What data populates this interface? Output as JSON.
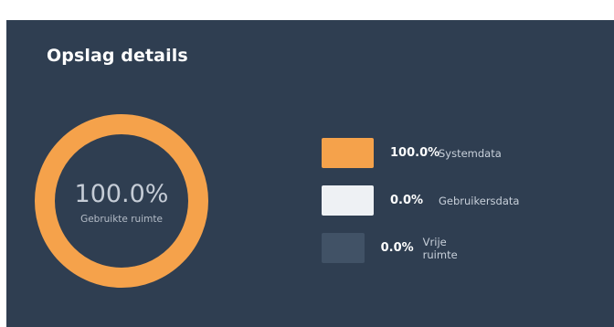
{
  "panel": {
    "title": "Opslag details"
  },
  "usage": {
    "value": "100.0%",
    "label": "Gebruikte ruimte",
    "used_fraction": 1.0
  },
  "legend": [
    {
      "percent": "100.0%",
      "label": "Systemdata",
      "color": "#f5a24b"
    },
    {
      "percent": "0.0%",
      "label": "Gebruikersdata",
      "color": "#eef1f4"
    },
    {
      "percent": "0.0%",
      "label": "Vrije ruimte",
      "color": "#415266"
    }
  ],
  "colors": {
    "panel_background": "#2f3e51",
    "ring_used": "#f5a24b",
    "ring_track": "#415266"
  }
}
